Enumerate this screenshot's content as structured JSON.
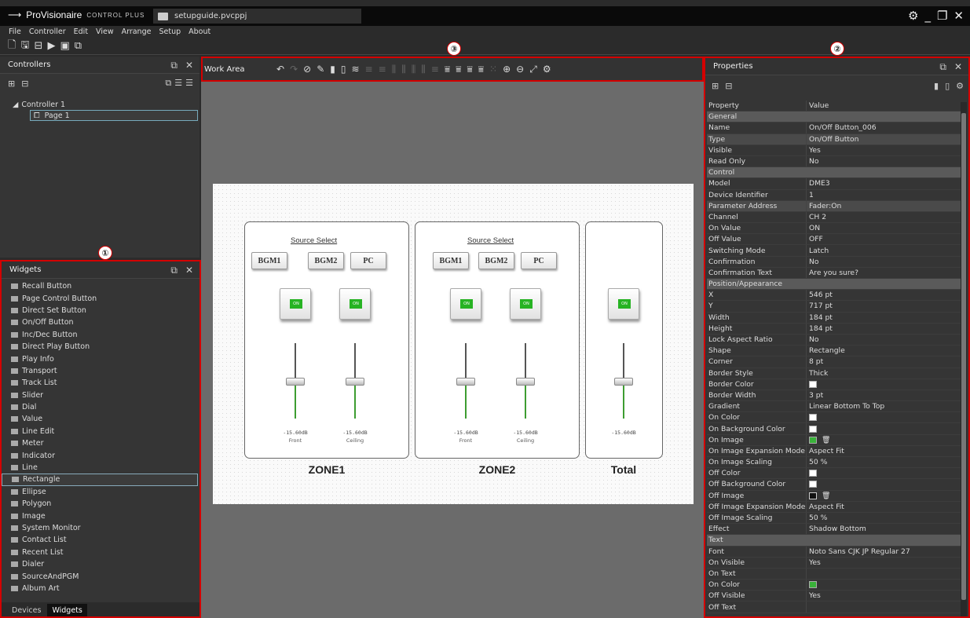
{
  "app": {
    "brand": "ProVisionaire",
    "brand_sub": "CONTROL PLUS",
    "file": "setupguide.pvcppj"
  },
  "window_controls": {
    "settings": "⚙",
    "minimize": "_",
    "maximize": "❐",
    "close": "✕"
  },
  "menu": [
    "File",
    "Controller",
    "Edit",
    "View",
    "Arrange",
    "Setup",
    "About"
  ],
  "controllers": {
    "title": "Controllers",
    "tree": [
      {
        "label": "Controller 1"
      },
      {
        "label": "Page 1"
      }
    ]
  },
  "widgets": {
    "title": "Widgets",
    "items": [
      "Recall Button",
      "Page Control Button",
      "Direct Set Button",
      "On/Off Button",
      "Inc/Dec Button",
      "Direct Play Button",
      "Play Info",
      "Transport",
      "Track List",
      "Slider",
      "Dial",
      "Value",
      "Line Edit",
      "Meter",
      "Indicator",
      "Line",
      "Rectangle",
      "Ellipse",
      "Polygon",
      "Image",
      "System Monitor",
      "Contact List",
      "Recent List",
      "Dialer",
      "SourceAndPGM",
      "Album Art"
    ],
    "selected": "Rectangle",
    "tabs": [
      "Devices",
      "Widgets"
    ],
    "active_tab": "Widgets"
  },
  "work_area": {
    "title": "Work Area"
  },
  "canvas": {
    "source_select": "Source Select",
    "sources": [
      "BGM1",
      "BGM2",
      "PC"
    ],
    "on_label": "ON",
    "db": "-15.60dB",
    "front": "Front",
    "ceiling": "Ceiling",
    "zones": [
      "ZONE1",
      "ZONE2",
      "Total"
    ]
  },
  "markers": [
    "①",
    "②",
    "③"
  ],
  "properties": {
    "title": "Properties",
    "col_property": "Property",
    "col_value": "Value",
    "rows": [
      {
        "k": "General",
        "v": "",
        "cat": true
      },
      {
        "k": "Name",
        "v": "On/Off Button_006"
      },
      {
        "k": "Type",
        "v": "On/Off Button",
        "alt": true
      },
      {
        "k": "Visible",
        "v": "Yes"
      },
      {
        "k": "Read Only",
        "v": "No"
      },
      {
        "k": "Control",
        "v": "",
        "cat": true
      },
      {
        "k": "Model",
        "v": "DME3"
      },
      {
        "k": "Device Identifier",
        "v": "1"
      },
      {
        "k": "Parameter Address",
        "v": "Fader:On",
        "alt": true
      },
      {
        "k": "Channel",
        "v": "CH 2"
      },
      {
        "k": "On Value",
        "v": "ON"
      },
      {
        "k": "Off Value",
        "v": "OFF"
      },
      {
        "k": "Switching Mode",
        "v": "Latch"
      },
      {
        "k": "Confirmation",
        "v": "No"
      },
      {
        "k": "Confirmation Text",
        "v": "Are you sure?"
      },
      {
        "k": "Position/Appearance",
        "v": "",
        "cat": true
      },
      {
        "k": "X",
        "v": "546 pt"
      },
      {
        "k": "Y",
        "v": "717 pt"
      },
      {
        "k": "Width",
        "v": "184 pt"
      },
      {
        "k": "Height",
        "v": "184 pt"
      },
      {
        "k": "Lock Aspect Ratio",
        "v": "No"
      },
      {
        "k": "Shape",
        "v": "Rectangle"
      },
      {
        "k": "Corner",
        "v": "8 pt"
      },
      {
        "k": "Border Style",
        "v": "Thick"
      },
      {
        "k": "Border Color",
        "v": "",
        "swatch": "white"
      },
      {
        "k": "Border Width",
        "v": "3 pt"
      },
      {
        "k": "Gradient",
        "v": "Linear Bottom To Top"
      },
      {
        "k": "On Color",
        "v": "",
        "swatch": "white"
      },
      {
        "k": "On Background Color",
        "v": "",
        "swatch": "white"
      },
      {
        "k": "On Image",
        "v": "",
        "swatch": "green",
        "trash": true
      },
      {
        "k": "On Image Expansion Mode",
        "v": "Aspect Fit"
      },
      {
        "k": "On Image Scaling",
        "v": "50 %"
      },
      {
        "k": "Off Color",
        "v": "",
        "swatch": "white"
      },
      {
        "k": "Off Background Color",
        "v": "",
        "swatch": "white"
      },
      {
        "k": "Off Image",
        "v": "",
        "swatch": "dark",
        "trash": true
      },
      {
        "k": "Off Image Expansion Mode",
        "v": "Aspect Fit"
      },
      {
        "k": "Off Image Scaling",
        "v": "50 %"
      },
      {
        "k": "Effect",
        "v": "Shadow Bottom"
      },
      {
        "k": "Text",
        "v": "",
        "cat": true
      },
      {
        "k": "Font",
        "v": "Noto Sans CJK JP Regular 27"
      },
      {
        "k": "On Visible",
        "v": "Yes"
      },
      {
        "k": "On Text",
        "v": ""
      },
      {
        "k": "On Color",
        "v": "",
        "swatch": "green"
      },
      {
        "k": "Off Visible",
        "v": "Yes"
      },
      {
        "k": "Off Text",
        "v": ""
      }
    ]
  },
  "colors": {
    "accent_red": "#d40000",
    "on_green": "#27b323",
    "fader_green": "#3d9d31"
  }
}
